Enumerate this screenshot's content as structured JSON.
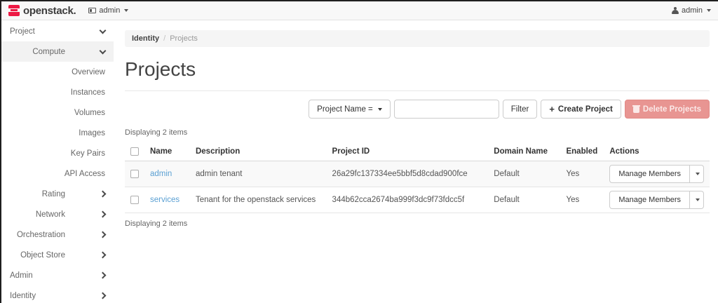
{
  "topbar": {
    "brand": "openstack.",
    "context_switcher_label": "admin",
    "user_menu_label": "admin"
  },
  "sidebar": {
    "items": [
      {
        "label": "Project",
        "level": 1,
        "state": "expanded"
      },
      {
        "label": "Compute",
        "level": 2,
        "state": "expanded",
        "active": true
      },
      {
        "label": "Overview",
        "level": 3
      },
      {
        "label": "Instances",
        "level": 3
      },
      {
        "label": "Volumes",
        "level": 3
      },
      {
        "label": "Images",
        "level": 3
      },
      {
        "label": "Key Pairs",
        "level": 3
      },
      {
        "label": "API Access",
        "level": 3
      },
      {
        "label": "Rating",
        "level": 2,
        "state": "collapsed"
      },
      {
        "label": "Network",
        "level": 2,
        "state": "collapsed"
      },
      {
        "label": "Orchestration",
        "level": 2,
        "state": "collapsed"
      },
      {
        "label": "Object Store",
        "level": 2,
        "state": "collapsed"
      },
      {
        "label": "Admin",
        "level": 1,
        "state": "collapsed"
      },
      {
        "label": "Identity",
        "level": 1,
        "state": "collapsed"
      }
    ]
  },
  "breadcrumb": {
    "parent": "Identity",
    "separator": "/",
    "current": "Projects"
  },
  "page": {
    "title": "Projects"
  },
  "filter": {
    "dropdown_label": "Project Name =",
    "input_value": "",
    "input_placeholder": "",
    "filter_button": "Filter",
    "create_button": "Create Project",
    "delete_button": "Delete Projects"
  },
  "table": {
    "summary_top": "Displaying 2 items",
    "summary_bottom": "Displaying 2 items",
    "columns": [
      "Name",
      "Description",
      "Project ID",
      "Domain Name",
      "Enabled",
      "Actions"
    ],
    "rows": [
      {
        "name": "admin",
        "description": "admin tenant",
        "project_id": "26a29fc137334ee5bbf5d8cdad900fce",
        "domain_name": "Default",
        "enabled": "Yes",
        "action_label": "Manage Members"
      },
      {
        "name": "services",
        "description": "Tenant for the openstack services",
        "project_id": "344b62cca2674ba999f3dc9f73fdcc5f",
        "domain_name": "Default",
        "enabled": "Yes",
        "action_label": "Manage Members"
      }
    ]
  },
  "colors": {
    "brand_red": "#ed1944",
    "danger_button_bg": "#e89592",
    "link_blue": "#5ba0d3",
    "active_nav_bg": "#f2f2f2"
  }
}
